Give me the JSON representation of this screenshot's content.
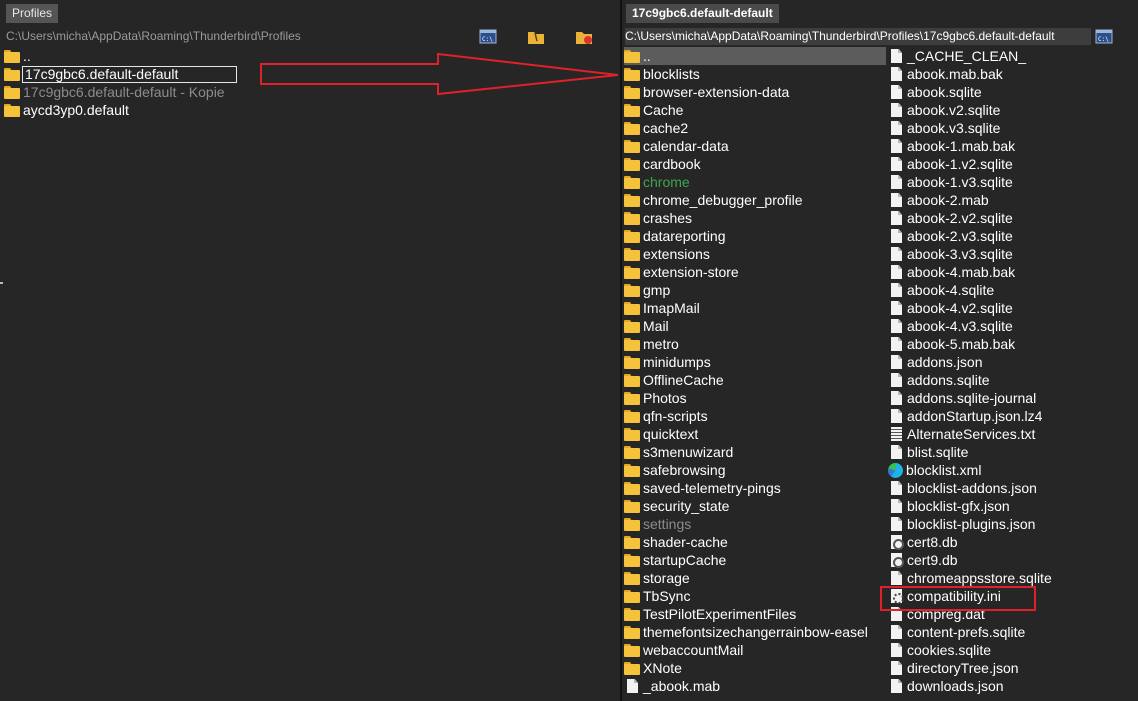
{
  "left": {
    "tab": "Profiles",
    "path": "C:\\Users\\micha\\AppData\\Roaming\\Thunderbird\\Profiles",
    "items": [
      {
        "name": "..",
        "type": "folder",
        "state": "normal"
      },
      {
        "name": "17c9gbc6.default-default",
        "type": "folder",
        "state": "selected"
      },
      {
        "name": "17c9gbc6.default-default - Kopie",
        "type": "folder",
        "state": "dim"
      },
      {
        "name": "aycd3yp0.default",
        "type": "folder",
        "state": "normal"
      }
    ]
  },
  "right": {
    "tab": "17c9gbc6.default-default",
    "path": "C:\\Users\\micha\\AppData\\Roaming\\Thunderbird\\Profiles\\17c9gbc6.default-default",
    "column1": [
      {
        "name": "..",
        "type": "folder",
        "state": "current"
      },
      {
        "name": "blocklists",
        "type": "folder",
        "state": "normal"
      },
      {
        "name": "browser-extension-data",
        "type": "folder",
        "state": "normal"
      },
      {
        "name": "Cache",
        "type": "folder",
        "state": "normal"
      },
      {
        "name": "cache2",
        "type": "folder",
        "state": "normal"
      },
      {
        "name": "calendar-data",
        "type": "folder",
        "state": "normal"
      },
      {
        "name": "cardbook",
        "type": "folder",
        "state": "normal"
      },
      {
        "name": "chrome",
        "type": "folder",
        "state": "green"
      },
      {
        "name": "chrome_debugger_profile",
        "type": "folder",
        "state": "normal"
      },
      {
        "name": "crashes",
        "type": "folder",
        "state": "normal"
      },
      {
        "name": "datareporting",
        "type": "folder",
        "state": "normal"
      },
      {
        "name": "extensions",
        "type": "folder",
        "state": "normal"
      },
      {
        "name": "extension-store",
        "type": "folder",
        "state": "normal"
      },
      {
        "name": "gmp",
        "type": "folder",
        "state": "normal"
      },
      {
        "name": "ImapMail",
        "type": "folder",
        "state": "normal"
      },
      {
        "name": "Mail",
        "type": "folder",
        "state": "normal"
      },
      {
        "name": "metro",
        "type": "folder",
        "state": "normal"
      },
      {
        "name": "minidumps",
        "type": "folder",
        "state": "normal"
      },
      {
        "name": "OfflineCache",
        "type": "folder",
        "state": "normal"
      },
      {
        "name": "Photos",
        "type": "folder",
        "state": "normal"
      },
      {
        "name": "qfn-scripts",
        "type": "folder",
        "state": "normal"
      },
      {
        "name": "quicktext",
        "type": "folder",
        "state": "normal"
      },
      {
        "name": "s3menuwizard",
        "type": "folder",
        "state": "normal"
      },
      {
        "name": "safebrowsing",
        "type": "folder",
        "state": "normal"
      },
      {
        "name": "saved-telemetry-pings",
        "type": "folder",
        "state": "normal"
      },
      {
        "name": "security_state",
        "type": "folder",
        "state": "normal"
      },
      {
        "name": "settings",
        "type": "folder",
        "state": "dim"
      },
      {
        "name": "shader-cache",
        "type": "folder",
        "state": "normal"
      },
      {
        "name": "startupCache",
        "type": "folder",
        "state": "normal"
      },
      {
        "name": "storage",
        "type": "folder",
        "state": "normal"
      },
      {
        "name": "TbSync",
        "type": "folder",
        "state": "normal"
      },
      {
        "name": "TestPilotExperimentFiles",
        "type": "folder",
        "state": "normal"
      },
      {
        "name": "themefontsizechangerrainbow-easel",
        "type": "folder",
        "state": "normal"
      },
      {
        "name": "webaccountMail",
        "type": "folder",
        "state": "normal"
      },
      {
        "name": "XNote",
        "type": "folder",
        "state": "normal"
      },
      {
        "name": "_abook.mab",
        "type": "file",
        "state": "normal"
      }
    ],
    "column2": [
      {
        "name": "_CACHE_CLEAN_",
        "type": "file",
        "state": "normal"
      },
      {
        "name": "abook.mab.bak",
        "type": "file",
        "state": "normal"
      },
      {
        "name": "abook.sqlite",
        "type": "file",
        "state": "normal"
      },
      {
        "name": "abook.v2.sqlite",
        "type": "file",
        "state": "normal"
      },
      {
        "name": "abook.v3.sqlite",
        "type": "file",
        "state": "normal"
      },
      {
        "name": "abook-1.mab.bak",
        "type": "file",
        "state": "normal"
      },
      {
        "name": "abook-1.v2.sqlite",
        "type": "file",
        "state": "normal"
      },
      {
        "name": "abook-1.v3.sqlite",
        "type": "file",
        "state": "normal"
      },
      {
        "name": "abook-2.mab",
        "type": "file",
        "state": "normal"
      },
      {
        "name": "abook-2.v2.sqlite",
        "type": "file",
        "state": "normal"
      },
      {
        "name": "abook-2.v3.sqlite",
        "type": "file",
        "state": "normal"
      },
      {
        "name": "abook-3.v3.sqlite",
        "type": "file",
        "state": "normal"
      },
      {
        "name": "abook-4.mab.bak",
        "type": "file",
        "state": "normal"
      },
      {
        "name": "abook-4.sqlite",
        "type": "file",
        "state": "normal"
      },
      {
        "name": "abook-4.v2.sqlite",
        "type": "file",
        "state": "normal"
      },
      {
        "name": "abook-4.v3.sqlite",
        "type": "file",
        "state": "normal"
      },
      {
        "name": "abook-5.mab.bak",
        "type": "file",
        "state": "normal"
      },
      {
        "name": "addons.json",
        "type": "file",
        "state": "normal"
      },
      {
        "name": "addons.sqlite",
        "type": "file",
        "state": "normal"
      },
      {
        "name": "addons.sqlite-journal",
        "type": "file",
        "state": "normal"
      },
      {
        "name": "addonStartup.json.lz4",
        "type": "file",
        "state": "normal"
      },
      {
        "name": "AlternateServices.txt",
        "type": "text",
        "state": "normal"
      },
      {
        "name": "blist.sqlite",
        "type": "file",
        "state": "normal"
      },
      {
        "name": "blocklist.xml",
        "type": "edge",
        "state": "normal"
      },
      {
        "name": "blocklist-addons.json",
        "type": "file",
        "state": "normal"
      },
      {
        "name": "blocklist-gfx.json",
        "type": "file",
        "state": "normal"
      },
      {
        "name": "blocklist-plugins.json",
        "type": "file",
        "state": "normal"
      },
      {
        "name": "cert8.db",
        "type": "db",
        "state": "normal"
      },
      {
        "name": "cert9.db",
        "type": "db",
        "state": "normal"
      },
      {
        "name": "chromeappsstore.sqlite",
        "type": "file",
        "state": "normal"
      },
      {
        "name": "compatibility.ini",
        "type": "ini",
        "state": "normal"
      },
      {
        "name": "compreg.dat",
        "type": "file",
        "state": "normal"
      },
      {
        "name": "content-prefs.sqlite",
        "type": "file",
        "state": "normal"
      },
      {
        "name": "cookies.sqlite",
        "type": "file",
        "state": "normal"
      },
      {
        "name": "directoryTree.json",
        "type": "file",
        "state": "normal"
      },
      {
        "name": "downloads.json",
        "type": "file",
        "state": "normal"
      }
    ]
  },
  "colors": {
    "background": "#262626",
    "folder": "#f5c33b",
    "green_text": "#3fa650",
    "dim_text": "#8c8c8c",
    "annotation_red": "#e0202a"
  }
}
